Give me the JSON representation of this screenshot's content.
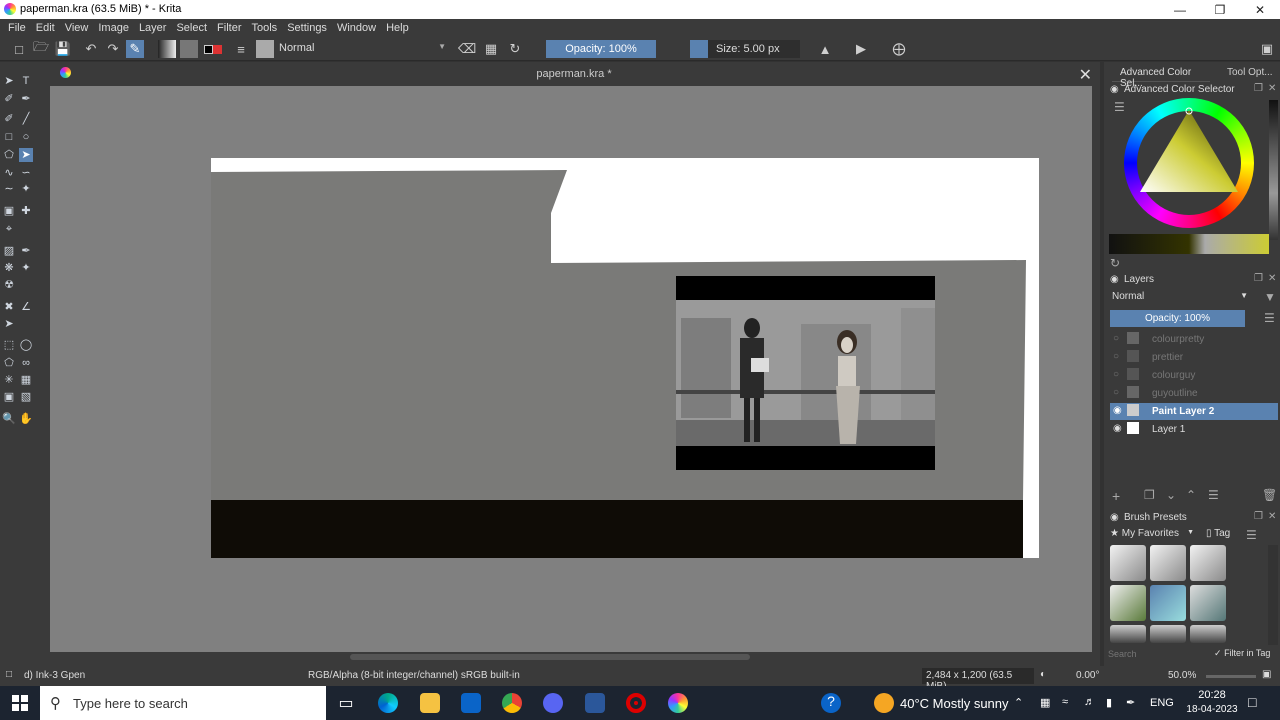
{
  "window": {
    "title": "paperman.kra (63.5 MiB)  * - Krita"
  },
  "menu": [
    "File",
    "Edit",
    "View",
    "Image",
    "Layer",
    "Select",
    "Filter",
    "Tools",
    "Settings",
    "Window",
    "Help"
  ],
  "toolbar": {
    "blend_mode": "Normal",
    "opacity": "Opacity: 100%",
    "size": "Size: 5.00 px"
  },
  "document": {
    "tab_title": "paperman.kra *"
  },
  "dockers": {
    "tabs": [
      "Advanced Color Sel...",
      "Tool Opt..."
    ],
    "color_selector_title": "Advanced Color Selector",
    "layers_title": "Layers",
    "layers_blend": "Normal",
    "layers_opacity": "Opacity:  100%",
    "layers": [
      {
        "name": "colourpretty",
        "visible": false,
        "selected": false
      },
      {
        "name": "prettier",
        "visible": false,
        "selected": false
      },
      {
        "name": "colourguy",
        "visible": false,
        "selected": false
      },
      {
        "name": "guyoutline",
        "visible": false,
        "selected": false
      },
      {
        "name": "Paint Layer 2",
        "visible": true,
        "selected": true
      },
      {
        "name": "Layer 1",
        "visible": true,
        "selected": false
      }
    ],
    "brush_presets_title": "Brush Presets",
    "brush_tag": "My Favorites",
    "tag_label": "Tag",
    "search_placeholder": "Search",
    "filter_in_tag": "Filter in Tag"
  },
  "status": {
    "brush": "d) Ink-3 Gpen",
    "color_space": "RGB/Alpha (8-bit integer/channel)  sRGB built-in",
    "image_size": "2,484 x 1,200 (63.5 MiB)",
    "rotation": "0.00°",
    "zoom": "50.0%"
  },
  "taskbar": {
    "search_placeholder": "Type here to search",
    "weather": "40°C  Mostly sunny",
    "lang": "ENG",
    "time": "20:28",
    "date": "18-04-2023"
  }
}
